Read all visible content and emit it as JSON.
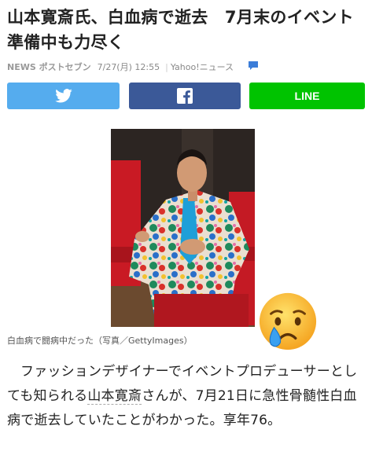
{
  "article": {
    "headline": "山本寛斎氏、白血病で逝去　7月末のイベント準備中も力尽く",
    "source": "NEWS ポストセブン",
    "date": "7/27(月) 12:55",
    "separator": "|",
    "publisher": "Yahoo!ニュース"
  },
  "share": {
    "line_label": "LINE",
    "twitter_color": "#55acee",
    "facebook_color": "#3b5998",
    "line_color": "#00c300"
  },
  "photo": {
    "caption": "白血病で闘病中だった（写真／GettyImages）"
  },
  "body": {
    "before": "ファッションデザイナーでイベントプロデューサーとしても知られる",
    "keyword": "山本寛斎",
    "after": "さんが、7月21日に急性骨髄性白血病で逝去していたことがわかった。享年76。"
  },
  "icons": {
    "comment": "speech-bubble-icon",
    "twitter": "twitter-bird-icon",
    "facebook": "facebook-f-icon",
    "emoji": "crying-face-emoji"
  }
}
